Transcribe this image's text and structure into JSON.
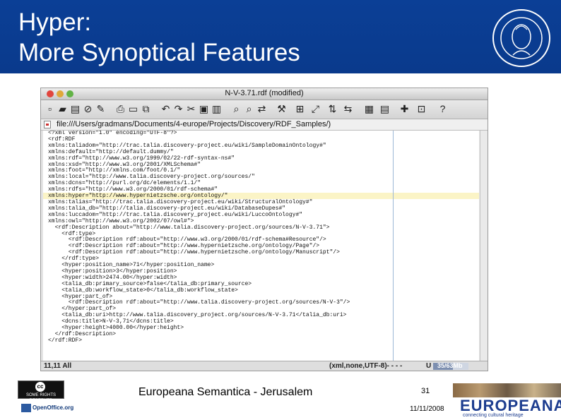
{
  "slide": {
    "title_line1": "Hyper:",
    "title_line2": "More Synoptical Features",
    "footer_text": "Europeana Semantica - Jerusalem",
    "page_number": "31",
    "date": "11/11/2008"
  },
  "window": {
    "title": "N-V-3.71.rdf (modified)",
    "path": "file:///Users/gradmans/Documents/4-europe/Projects/Discovery/RDF_Samples/)"
  },
  "editor": {
    "lines": [
      "<?xml version=\"1.0\" encoding=\"UTF-8\"?>",
      "<rdf:RDF",
      "xmlns:taliadom=\"http://trac.talia.discovery-project.eu/wiki/SampleDomainOntology#\"",
      "xmlns:default=\"http://default.dummy/\"",
      "xmlns:rdf=\"http://www.w3.org/1999/02/22-rdf-syntax-ns#\"",
      "xmlns:xsd=\"http://www.w3.org/2001/XMLSchema#\"",
      "xmlns:foot=\"http://xmlns.com/foot/0.1/\"",
      "xmlns:local=\"http://www.talia.discovery-project.org/sources/\"",
      "xmlns:dcns=\"http://purl.org/dc/elements/1.1/\"",
      "xmlns:rdfs=\"http://www.w3.org/2000/01/rdf-schema#\"",
      "xmlns:hyper=\"http://www.hypernietzsche.org/ontology/\"",
      "xmlns:talias=\"http://trac.talia.discovery-project.eu/wiki/StructuralOntology#\"",
      "xmlns:talia_db=\"http://talia.discovery-project.eu/wiki/DatabaseDupes#\"",
      "xmlns:luccadom=\"http://trac.talia.discovery_project.eu/wiki/LuccoOntology#\"",
      "xmlns:owl=\"http://www.w3.org/2002/07/owl#\">",
      "  <rdf:Description about=\"http://www.talia.discovery-project.org/sources/N-V-3.71\">",
      "    <rdf:type>",
      "      <rdf:Description rdf:about=\"http://www.w3.org/2000/01/rdf-schema#Resource\"/>",
      "      <rdf:Description rdf:about=\"http://www.hypernietzsche.org/ontology/Page\"/>",
      "      <rdf:Description rdf:about=\"http://www.hypernietzsche.org/ontology/Manuscript\"/>",
      "    </rdf:type>",
      "    <hyper:position_name>71</hyper:position_name>",
      "    <hyper:position>3</hyper:position>",
      "    <hyper:width>2474.00</hyper:width>",
      "    <talia_db:primary_source>false</talia_db:primary_source>",
      "    <talia_db:workflow_state>0</talia_db:workflow_state>",
      "    <hyper:part_of>",
      "      <rdf:Description rdf:about=\"http://www.talia.discovery-project.org/sources/N-V-3\"/>",
      "    </hyper:part_of>",
      "    <talia_db:uri>http://www.talia.discovery_project.org/sources/N-V-3.71</talia_db:uri>",
      "    <dcns:title>N-V-3,71</dcns:title>",
      "    <hyper:height>4000.00</hyper:height>",
      "  </rdf:Description>",
      "</rdf:RDF>"
    ]
  },
  "status": {
    "position": "11,11 All",
    "mode": "(xml,none,UTF-8)- - - -",
    "memory_used": "U",
    "memory_text": "35/63Mb",
    "memory_fraction": 0.55
  },
  "logos": {
    "cc_text": "SOME RIGHTS RESERVED",
    "cc_symbol": "cc",
    "openoffice_text": "OpenOffice.org",
    "europeana_name": "EUROPEANA",
    "europeana_tagline": "connecting cultural heritage",
    "seal_icon": "university-seal-icon"
  },
  "colors": {
    "header_bg": "#0b3f96",
    "europeana_blue": "#1d3d8f"
  }
}
